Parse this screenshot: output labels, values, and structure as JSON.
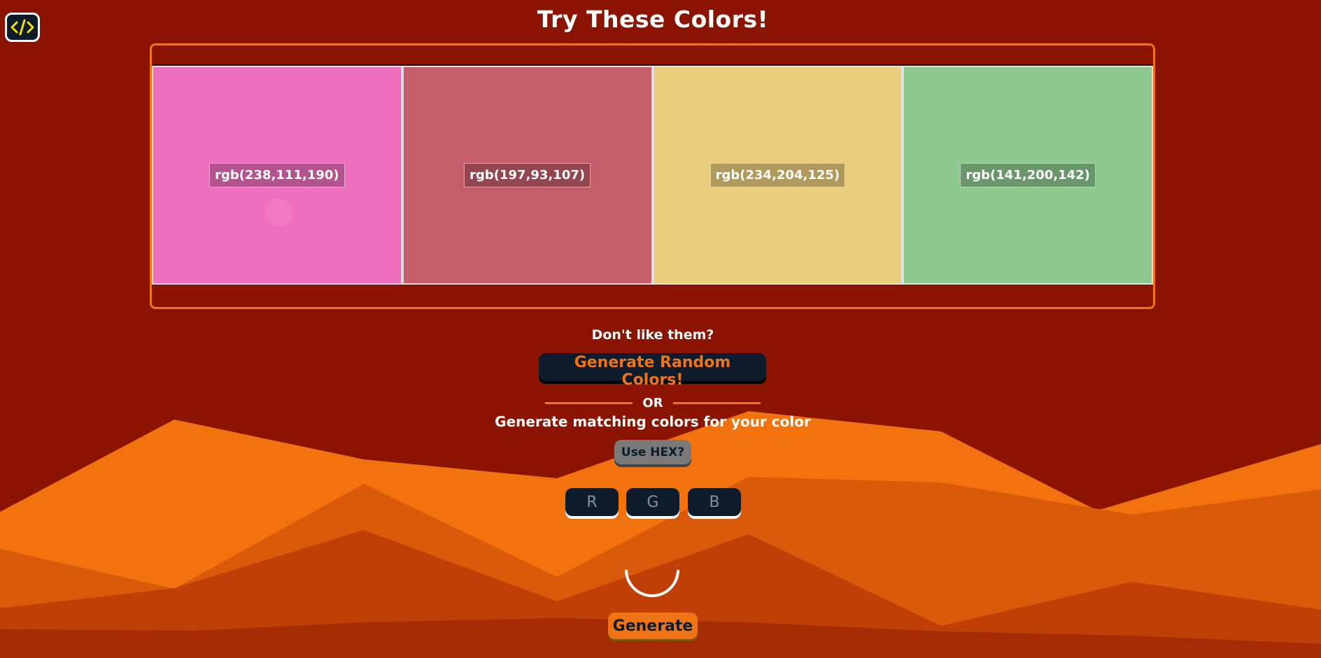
{
  "header": {
    "title": "Try These Colors!",
    "code_icon": "code-icon"
  },
  "palette": {
    "swatches": [
      {
        "label": "rgb(238,111,190)",
        "color": "#ee6fbe"
      },
      {
        "label": "rgb(197,93,107)",
        "color": "#c55d6b"
      },
      {
        "label": "rgb(234,204,125)",
        "color": "#eacc7d"
      },
      {
        "label": "rgb(141,200,142)",
        "color": "#8dc88e"
      }
    ]
  },
  "actions": {
    "prompt": "Don't like them?",
    "random_label": "Generate Random Colors!",
    "or_label": "OR",
    "match_label": "Generate matching colors for your color",
    "hex_toggle_label": "Use HEX?",
    "inputs": {
      "r_placeholder": "R",
      "g_placeholder": "G",
      "b_placeholder": "B"
    },
    "generate_label": "Generate"
  },
  "theme": {
    "background": "#8a1400",
    "accent": "#f07316",
    "dark_button": "#0d1b2a",
    "icon_color": "#f5e000"
  }
}
